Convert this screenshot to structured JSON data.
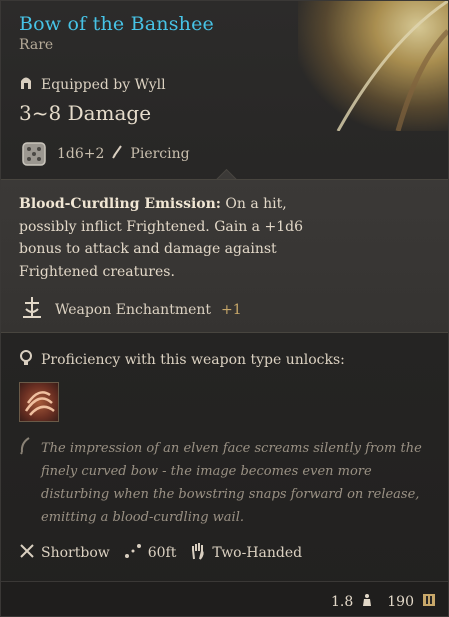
{
  "item": {
    "name": "Bow of the Banshee",
    "rarity": "Rare",
    "equipped_by": "Equipped by Wyll",
    "damage": "3~8 Damage",
    "dice": "1d6+2",
    "damage_type": "Piercing"
  },
  "enchant": {
    "title": "Blood-Curdling Emission:",
    "text": " On a hit, possibly inflict Frightened. Gain a +1d6 bonus to attack and damage against Frightened creatures.",
    "weapon_enchantment_label": "Weapon Enchantment",
    "weapon_enchantment_value": "+1"
  },
  "proficiency": {
    "label": "Proficiency with this weapon type unlocks:"
  },
  "lore": "The impression of an elven face screams silently from the finely curved bow - the image becomes even more disturbing when the bowstring snaps forward on release, emitting a blood-curdling wail.",
  "properties": [
    {
      "label": "Shortbow",
      "icon": "crossed-arrows-icon"
    },
    {
      "label": "60ft",
      "icon": "range-icon"
    },
    {
      "label": "Two-Handed",
      "icon": "hand-icon"
    }
  ],
  "footer": {
    "weight": "1.8",
    "weight_icon": "weight-icon",
    "value": "190",
    "value_icon": "gold-icon"
  },
  "colors": {
    "name": "#47c3e6",
    "accent": "#c8a86a"
  }
}
